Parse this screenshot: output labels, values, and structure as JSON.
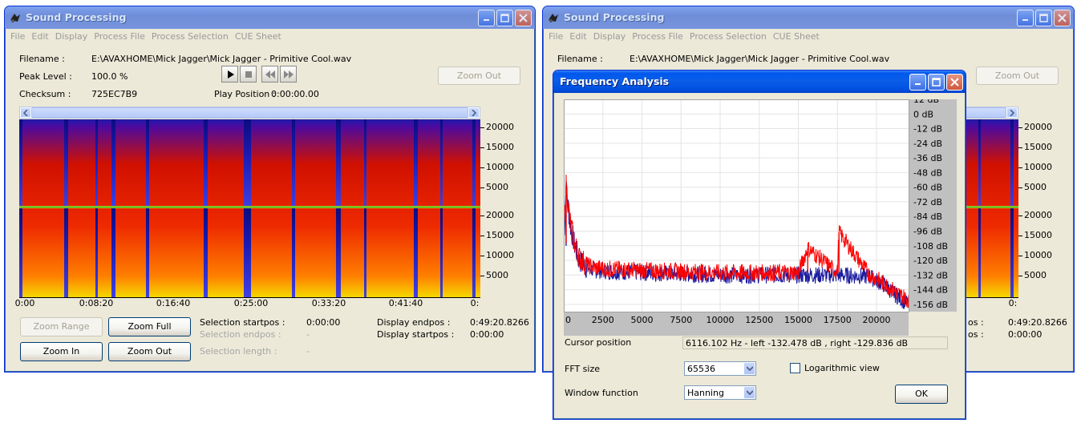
{
  "main": {
    "title": "Sound Processing",
    "menu": [
      "File",
      "Edit",
      "Display",
      "Process File",
      "Process Selection",
      "CUE Sheet"
    ],
    "info": {
      "filename_label": "Filename :",
      "filename_value": "E:\\AVAXHOME\\Mick Jagger\\Mick Jagger - Primitive Cool.wav",
      "peak_label": "Peak Level :",
      "peak_value": "100.0 %",
      "checksum_label": "Checksum :",
      "checksum_value": "725EC7B9",
      "play_position_label": "Play Position :",
      "play_position_value": "0:00:00.00"
    },
    "zoom_out_top": "Zoom Out",
    "freq_ticks": [
      "20000",
      "15000",
      "10000",
      "5000"
    ],
    "time_ticks": [
      "0:00",
      "0:08:20",
      "0:16:40",
      "0:25:00",
      "0:33:20",
      "0:41:40",
      "0:"
    ],
    "buttons": {
      "zoom_range": "Zoom Range",
      "zoom_full": "Zoom Full",
      "zoom_in": "Zoom In",
      "zoom_out": "Zoom Out"
    },
    "selection": {
      "startpos_label": "Selection startpos :",
      "startpos_value": "0:00:00",
      "endpos_label": "Selection endpos :",
      "endpos_value": "-",
      "length_label": "Selection length :",
      "length_value": "-"
    },
    "display": {
      "endpos_label": "Display endpos :",
      "endpos_value": "0:49:20.8266",
      "startpos_label": "Display startpos :",
      "startpos_value": "0:00:00"
    }
  },
  "second": {
    "title": "Sound Processing",
    "menu": [
      "File",
      "Edit",
      "Display",
      "Process File",
      "Process Selection",
      "CUE Sheet"
    ],
    "filename_label": "Filename :",
    "filename_value": "E:\\AVAXHOME\\Mick Jagger\\Mick Jagger - Primitive Cool.wav",
    "zoom_out_top": "Zoom Out",
    "freq_ticks": [
      "20000",
      "15000",
      "10000",
      "5000"
    ],
    "time_partial": "0:",
    "endpos_partial": "os :",
    "endpos_value": "0:49:20.8266",
    "startpos_partial": "os :",
    "startpos_value": "0:00:00"
  },
  "freq": {
    "title": "Frequency Analysis",
    "db_ticks": [
      "12 dB",
      "0 dB",
      "-12 dB",
      "-24 dB",
      "-36 dB",
      "-48 dB",
      "-60 dB",
      "-72 dB",
      "-84 dB",
      "-96 dB",
      "-108 dB",
      "-120 dB",
      "-132 dB",
      "-144 dB",
      "-156 dB"
    ],
    "hz_ticks": [
      "0",
      "2500",
      "5000",
      "7500",
      "10000",
      "12500",
      "15000",
      "17500",
      "20000"
    ],
    "cursor_label": "Cursor position",
    "cursor_value": "6116.102 Hz  -  left -132.478 dB , right -129.836 dB",
    "fft_label": "FFT size",
    "fft_value": "65536",
    "window_label": "Window function",
    "window_value": "Hanning",
    "log_label": "Logarithmic view",
    "log_checked": false,
    "ok": "OK"
  },
  "chart_data": {
    "type": "line",
    "xlabel": "",
    "ylabel": "",
    "xlim": [
      0,
      22050
    ],
    "ylim": [
      -162,
      12
    ],
    "x_ticks": [
      0,
      2500,
      5000,
      7500,
      10000,
      12500,
      15000,
      17500,
      20000
    ],
    "y_ticks": [
      12,
      0,
      -12,
      -24,
      -36,
      -48,
      -60,
      -72,
      -84,
      -96,
      -108,
      -120,
      -132,
      -144,
      -156
    ],
    "grid": true,
    "series": [
      {
        "color": "#1a1aa0",
        "x": [
          0,
          150,
          400,
          700,
          1000,
          1500,
          2000,
          3000,
          5000,
          7500,
          10000,
          12500,
          15000,
          17500,
          19500,
          20500,
          21200,
          22050
        ],
        "values": [
          -108,
          -60,
          -90,
          -108,
          -120,
          -126,
          -128,
          -129,
          -130,
          -131,
          -132,
          -132,
          -132,
          -132,
          -133,
          -140,
          -148,
          -156
        ]
      },
      {
        "color": "#ff0000",
        "x": [
          0,
          150,
          400,
          700,
          1000,
          1500,
          2000,
          3000,
          5000,
          7500,
          10000,
          12500,
          15000,
          15600,
          17500,
          17600,
          19500,
          20500,
          21200,
          22050
        ],
        "values": [
          -106,
          -58,
          -88,
          -106,
          -118,
          -124,
          -126,
          -127,
          -128,
          -129,
          -130,
          -130,
          -130,
          -110,
          -130,
          -97,
          -131,
          -139,
          -146,
          -152
        ]
      }
    ]
  }
}
